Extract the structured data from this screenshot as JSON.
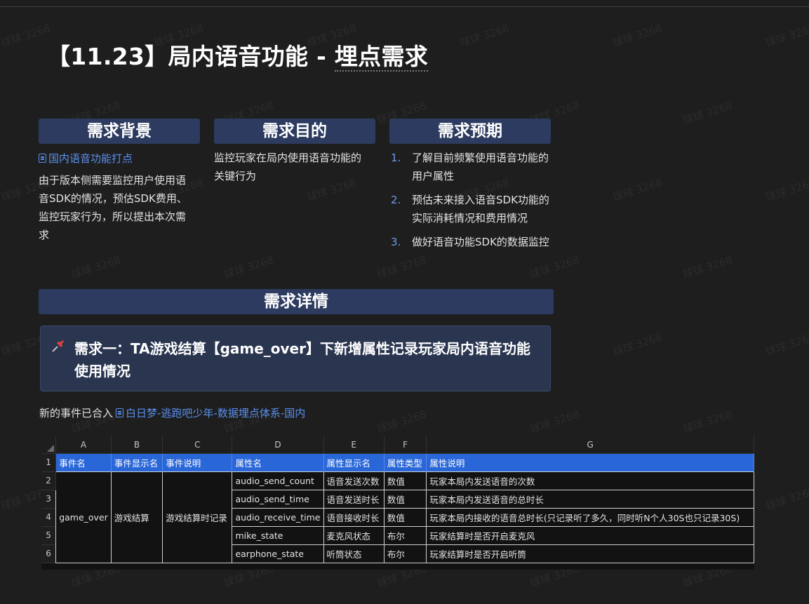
{
  "title": {
    "prefix": "【11.23】局内语音功能 - ",
    "underlined": "埋点需求"
  },
  "sections": {
    "background": {
      "heading": "需求背景",
      "link_text": "国内语音功能打点",
      "paragraph": "由于版本侧需要监控用户使用语音SDK的情况，预估SDK费用、监控玩家行为，所以提出本次需求"
    },
    "purpose": {
      "heading": "需求目的",
      "paragraph": "监控玩家在局内使用语音功能的关键行为"
    },
    "expectation": {
      "heading": "需求预期",
      "items": [
        {
          "num": "1.",
          "text": "了解目前频繁使用语音功能的用户属性"
        },
        {
          "num": "2.",
          "text": "预估未来接入语音SDK功能的实际消耗情况和费用情况"
        },
        {
          "num": "3.",
          "text": "做好语音功能SDK的数据监控"
        }
      ]
    }
  },
  "details": {
    "heading": "需求详情",
    "callout_icon": "pushpin-icon",
    "callout_text": "需求一：TA游戏结算【game_over】下新增属性记录玩家局内语音功能使用情况",
    "merged_prefix": "新的事件已合入",
    "merged_link": "白日梦-逃跑吧少年-数据埋点体系-国内"
  },
  "spreadsheet": {
    "col_letters": [
      "A",
      "B",
      "C",
      "D",
      "E",
      "F",
      "G"
    ],
    "row_numbers": [
      "1",
      "2",
      "3",
      "4",
      "5",
      "6"
    ],
    "headers": [
      "事件名",
      "事件显示名",
      "事件说明",
      "属性名",
      "属性显示名",
      "属性类型",
      "属性说明"
    ],
    "event": {
      "name": "game_over",
      "display": "游戏结算",
      "desc": "游戏结算时记录"
    },
    "rows": [
      {
        "attr": "audio_send_count",
        "display": "语音发送次数",
        "type": "数值",
        "desc": "玩家本局内发送语音的次数"
      },
      {
        "attr": "audio_send_time",
        "display": "语音发送时长",
        "type": "数值",
        "desc": "玩家本局内发送语音的总时长"
      },
      {
        "attr": "audio_receive_time",
        "display": "语音接收时长",
        "type": "数值",
        "desc": "玩家本局内接收的语音总时长(只记录听了多久，同时听N个人30S也只记录30S)"
      },
      {
        "attr": "mike_state",
        "display": "麦克风状态",
        "type": "布尔",
        "desc": "玩家结算时是否开启麦克风"
      },
      {
        "attr": "earphone_state",
        "display": "听筒状态",
        "type": "布尔",
        "desc": "玩家结算时是否开启听筒"
      }
    ]
  },
  "watermark": "球球 3268"
}
